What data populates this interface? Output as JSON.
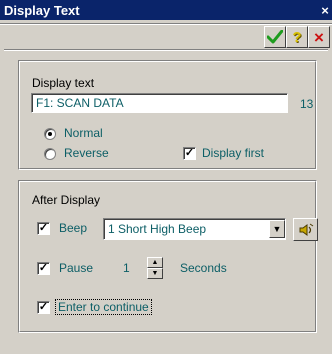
{
  "window": {
    "title": "Display Text",
    "close_glyph": "×"
  },
  "toolbar": {
    "ok_icon": "check-icon",
    "help_icon": "question-icon",
    "cancel_icon": "x-icon",
    "help_glyph": "?",
    "cancel_glyph": "×"
  },
  "display_group": {
    "label": "Display text",
    "text_value": "F1: SCAN DATA",
    "char_count": "13",
    "radio_normal": "Normal",
    "radio_reverse": "Reverse",
    "display_first": "Display first",
    "selected": "Normal",
    "display_first_checked": true
  },
  "after_group": {
    "label": "After Display",
    "beep_label": "Beep",
    "beep_value": "1 Short High Beep",
    "beep_checked": true,
    "pause_label": "Pause",
    "pause_value": "1",
    "pause_unit": "Seconds",
    "pause_checked": true,
    "enter_label": "Enter to continue",
    "enter_checked": true,
    "check_glyph": "✓",
    "dropdown_glyph": "▼",
    "spin_up_glyph": "▲",
    "spin_down_glyph": "▼"
  },
  "colors": {
    "title_bg": "#0a246a",
    "face": "#d4d0c8",
    "teal_text": "#0c5e66",
    "ok_green": "#1e9c1e",
    "cancel_red": "#cc1111",
    "help_yellow": "#d8c000"
  }
}
